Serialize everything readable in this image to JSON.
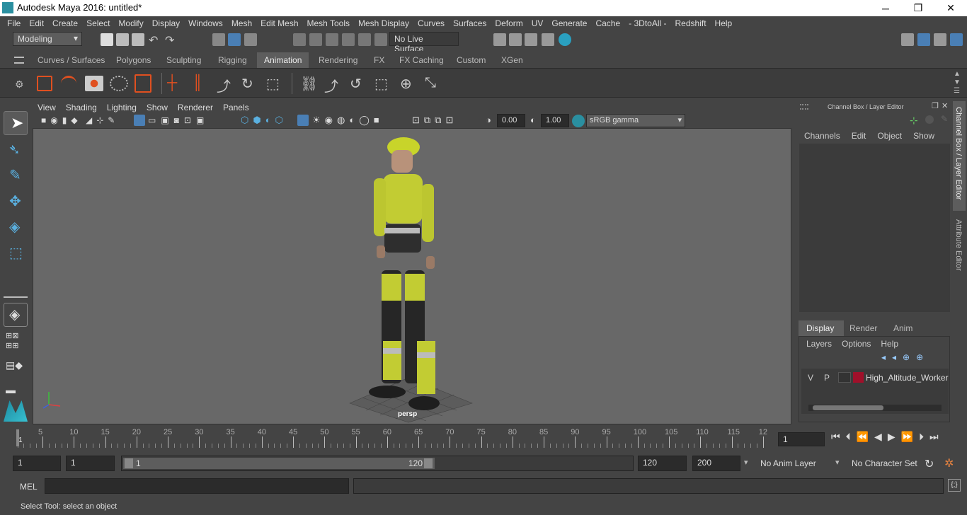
{
  "window": {
    "title": "Autodesk Maya 2016: untitled*",
    "controls": [
      "─",
      "❐",
      "✕"
    ]
  },
  "menubar": [
    "File",
    "Edit",
    "Create",
    "Select",
    "Modify",
    "Display",
    "Windows",
    "Mesh",
    "Edit Mesh",
    "Mesh Tools",
    "Mesh Display",
    "Curves",
    "Surfaces",
    "Deform",
    "UV",
    "Generate",
    "Cache",
    "- 3DtoAll -",
    "Redshift",
    "Help"
  ],
  "status": {
    "mode": "Modeling",
    "live_surface": "No Live Surface"
  },
  "shelf_tabs": [
    "Curves / Surfaces",
    "Polygons",
    "Sculpting",
    "Rigging",
    "Animation",
    "Rendering",
    "FX",
    "FX Caching",
    "Custom",
    "XGen"
  ],
  "active_shelf_tab": "Animation",
  "panel_menu": [
    "View",
    "Shading",
    "Lighting",
    "Show",
    "Renderer",
    "Panels"
  ],
  "panel_toolbar": {
    "exposure": "0.00",
    "gamma": "1.00",
    "color_space": "sRGB gamma"
  },
  "viewport": {
    "camera_label": "persp"
  },
  "channel_box": {
    "title": "Channel Box / Layer Editor",
    "menus": [
      "Channels",
      "Edit",
      "Object",
      "Show"
    ],
    "side_tabs": [
      "Channel Box / Layer Editor",
      "Attribute Editor"
    ]
  },
  "layer_editor": {
    "tabs": [
      "Display",
      "Render",
      "Anim"
    ],
    "active_tab": "Display",
    "menus": [
      "Layers",
      "Options",
      "Help"
    ],
    "layers": [
      {
        "v": "V",
        "p": "P",
        "color": "#a0102a",
        "name": "High_Altitude_Worker"
      }
    ]
  },
  "timeline": {
    "ticks": [
      "5",
      "10",
      "15",
      "20",
      "25",
      "30",
      "35",
      "40",
      "45",
      "50",
      "55",
      "60",
      "65",
      "70",
      "75",
      "80",
      "85",
      "90",
      "95",
      "100",
      "105",
      "110",
      "115",
      "12"
    ],
    "start_tick": "1",
    "current_frame": "1"
  },
  "range": {
    "start": "1",
    "playback_start": "1",
    "slider_start": "1",
    "slider_end": "120",
    "playback_end": "120",
    "end": "200",
    "anim_layer": "No Anim Layer",
    "character_set": "No Character Set"
  },
  "command": {
    "label": "MEL",
    "value": ""
  },
  "help_line": "Select Tool: select an object",
  "colors": {
    "bg": "#444444",
    "viewport": "#686868",
    "accent": "#5d5d5d",
    "highlight_blue": "#4a7fb5"
  }
}
